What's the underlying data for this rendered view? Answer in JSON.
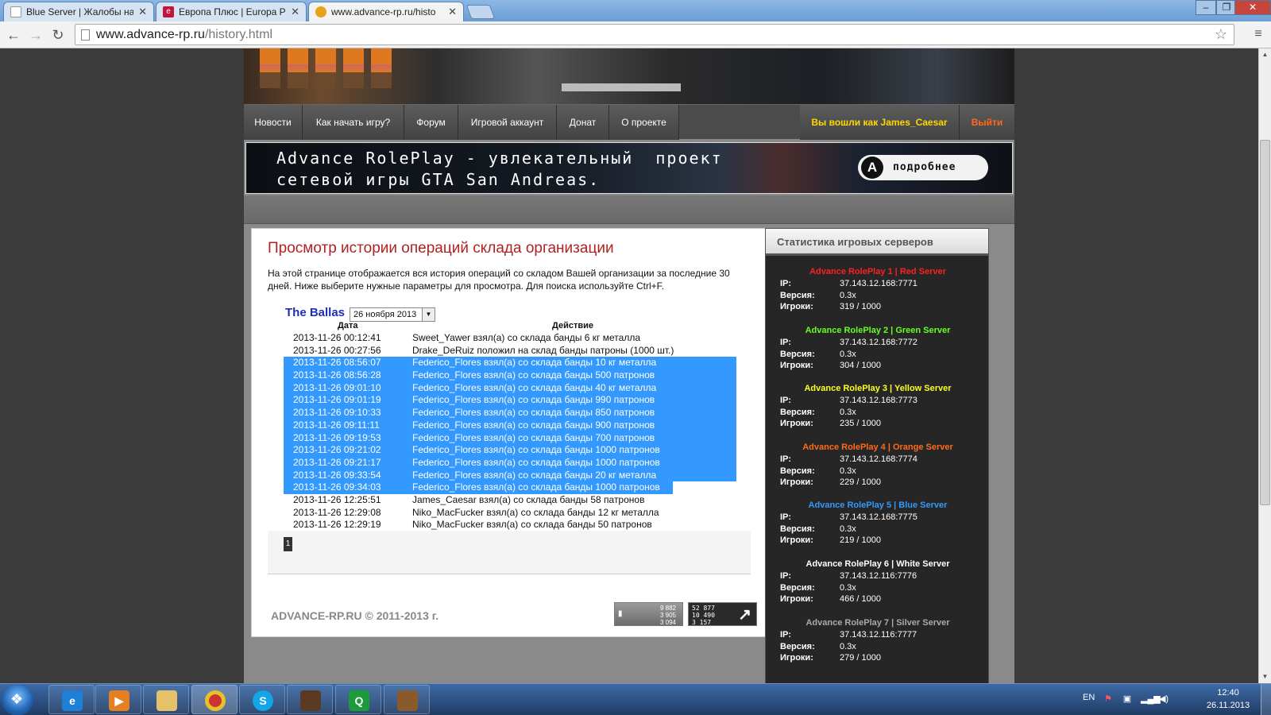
{
  "browser": {
    "tabs": [
      {
        "title": "Blue Server | Жалобы на (",
        "favicon": "page-icon"
      },
      {
        "title": "Европа Плюс | Europa Plus",
        "favicon": "europa-plus-icon"
      },
      {
        "title": "www.advance-rp.ru/histo",
        "favicon": "advance-rp-icon"
      }
    ],
    "url_host": "www.advance-rp.ru",
    "url_path": "/history.html"
  },
  "nav": {
    "items": [
      "Новости",
      "Как начать игру?",
      "Форум",
      "Игровой аккаунт",
      "Донат",
      "О проекте"
    ],
    "user_label": "Вы вошли как James_Caesar",
    "logout_label": "Выйти"
  },
  "banner": {
    "text": "Advance RolePlay - увлекательный  проект\nсетевой игры GTA San Andreas.",
    "button_label": "подробнее",
    "logo_letter": "A"
  },
  "content": {
    "title": "Просмотр истории операций склада организации",
    "intro": "На этой странице отображается вся история операций со складом Вашей организации за последние 30 дней. Ниже выберите нужные параметры для просмотра. Для поиска используйте Ctrl+F.",
    "gang_name": "The Ballas",
    "selected_date": "26 ноября 2013",
    "col_date": "Дата",
    "col_action": "Действие",
    "rows": [
      {
        "date": "2013-11-26 00:12:41",
        "action": "Sweet_Yawer взял(а) со склада банды 6 кг металла"
      },
      {
        "date": "2013-11-26 00:27:56",
        "action": "Drake_DeRuiz положил на склад банды патроны (1000 шт.)"
      },
      {
        "date": "2013-11-26 08:56:07",
        "action": "Federico_Flores взял(а) со склада банды 10 кг металла"
      },
      {
        "date": "2013-11-26 08:56:28",
        "action": "Federico_Flores взял(а) со склада банды 500 патронов"
      },
      {
        "date": "2013-11-26 09:01:10",
        "action": "Federico_Flores взял(а) со склада банды 40 кг металла"
      },
      {
        "date": "2013-11-26 09:01:19",
        "action": "Federico_Flores взял(а) со склада банды 990 патронов"
      },
      {
        "date": "2013-11-26 09:10:33",
        "action": "Federico_Flores взял(а) со склада банды 850 патронов"
      },
      {
        "date": "2013-11-26 09:11:11",
        "action": "Federico_Flores взял(а) со склада банды 900 патронов"
      },
      {
        "date": "2013-11-26 09:19:53",
        "action": "Federico_Flores взял(а) со склада банды 700 патронов"
      },
      {
        "date": "2013-11-26 09:21:02",
        "action": "Federico_Flores взял(а) со склада банды 1000 патронов"
      },
      {
        "date": "2013-11-26 09:21:17",
        "action": "Federico_Flores взял(а) со склада банды 1000 патронов"
      },
      {
        "date": "2013-11-26 09:33:54",
        "action": "Federico_Flores взял(а) со склада банды 20 кг металла"
      },
      {
        "date": "2013-11-26 09:34:03",
        "action": "Federico_Flores взял(а) со склада банды 1000 патронов"
      },
      {
        "date": "2013-11-26 12:25:51",
        "action": "James_Caesar взял(а) со склада банды 58 патронов"
      },
      {
        "date": "2013-11-26 12:29:08",
        "action": "Niko_MacFucker взял(а) со склада банды 12 кг металла"
      },
      {
        "date": "2013-11-26 12:29:19",
        "action": "Niko_MacFucker взял(а) со склада банды 50 патронов"
      }
    ],
    "page_number": "1",
    "copyright": "ADVANCE-RP.RU © 2011-2013 г.",
    "counter1": [
      "9 882",
      "3 905",
      "3 094"
    ],
    "counter2": [
      "52 877",
      "10 490",
      "3 157"
    ]
  },
  "sidebar": {
    "title": "Статистика игровых серверов",
    "ip_label": "IP:",
    "version_label": "Версия:",
    "players_label": "Игроки:",
    "servers": [
      {
        "name": "Advance RolePlay 1 | Red Server",
        "color": "#ff2020",
        "ip": "37.143.12.168:7771",
        "version": "0.3x",
        "players": "319 / 1000"
      },
      {
        "name": "Advance RolePlay 2 | Green Server",
        "color": "#66ff22",
        "ip": "37.143.12.168:7772",
        "version": "0.3x",
        "players": "304 / 1000"
      },
      {
        "name": "Advance RolePlay 3 | Yellow Server",
        "color": "#ffff22",
        "ip": "37.143.12.168:7773",
        "version": "0.3x",
        "players": "235 / 1000"
      },
      {
        "name": "Advance RolePlay 4 | Orange Server",
        "color": "#ff6a1a",
        "ip": "37.143.12.168:7774",
        "version": "0.3x",
        "players": "229 / 1000"
      },
      {
        "name": "Advance RolePlay 5 | Blue Server",
        "color": "#3399ff",
        "ip": "37.143.12.168:7775",
        "version": "0.3x",
        "players": "219 / 1000"
      },
      {
        "name": "Advance RolePlay 6 | White Server",
        "color": "#ffffff",
        "ip": "37.143.12.116:7776",
        "version": "0.3x",
        "players": "466 / 1000"
      },
      {
        "name": "Advance RolePlay 7 | Silver Server",
        "color": "#aaaaaa",
        "ip": "37.143.12.116:7777",
        "version": "0.3x",
        "players": "279 / 1000"
      }
    ]
  },
  "taskbar": {
    "lang": "EN",
    "time": "12:40",
    "date": "26.11.2013"
  }
}
